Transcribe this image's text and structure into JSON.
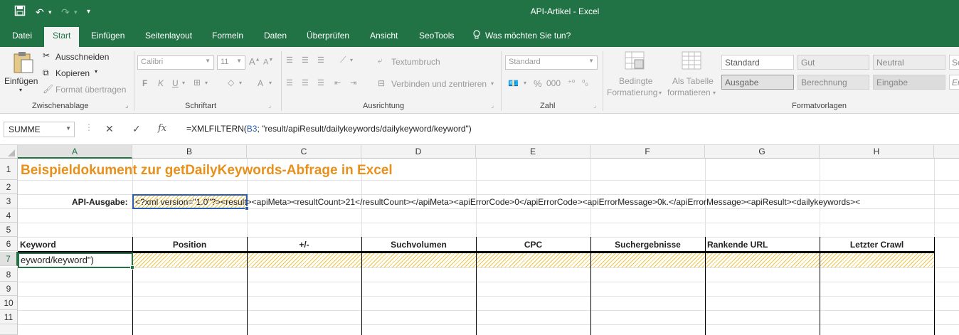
{
  "titlebar": {
    "title": "API-Artikel - Excel"
  },
  "tabs": [
    "Datei",
    "Start",
    "Einfügen",
    "Seitenlayout",
    "Formeln",
    "Daten",
    "Überprüfen",
    "Ansicht",
    "SeoTools"
  ],
  "tell_me": "Was möchten Sie tun?",
  "ribbon": {
    "clipboard": {
      "paste": "Einfügen",
      "cut": "Ausschneiden",
      "copy": "Kopieren",
      "format_painter": "Format übertragen",
      "label": "Zwischenablage"
    },
    "font": {
      "name": "Calibri",
      "size": "11",
      "label": "Schriftart"
    },
    "alignment": {
      "wrap": "Textumbruch",
      "merge": "Verbinden und zentrieren",
      "label": "Ausrichtung"
    },
    "number": {
      "format": "Standard",
      "label": "Zahl"
    },
    "styles": {
      "conditional_1": "Bedingte",
      "conditional_2": "Formatierung",
      "table_1": "Als Tabelle",
      "table_2": "formatieren",
      "label": "Formatvorlagen",
      "cells": [
        "Standard",
        "Gut",
        "Neutral",
        "Sc",
        "Ausgabe",
        "Berechnung",
        "Eingabe",
        "Er"
      ]
    }
  },
  "formula_bar": {
    "name_box": "SUMME",
    "prefix": "=XMLFILTERN(",
    "ref": "B3",
    "suffix": "; \"result/apiResult/dailykeywords/dailykeyword/keyword\")"
  },
  "columns": [
    "A",
    "B",
    "C",
    "D",
    "E",
    "F",
    "G",
    "H"
  ],
  "rows": [
    "1",
    "2",
    "3",
    "4",
    "5",
    "6",
    "7",
    "8",
    "9",
    "10",
    "11"
  ],
  "sheet": {
    "title": "Beispieldokument zur getDailyKeywords-Abfrage in Excel",
    "api_label": "API-Ausgabe:",
    "api_value_start": "<?xml version=\"1.0\"?><re",
    "api_value_rest": "sult><apiMeta><resultCount>21</resultCount></apiMeta><apiErrorCode>0</apiErrorCode><apiErrorMessage>0k.</apiErrorMessage><apiResult><dailykeywords><",
    "headers": [
      "Keyword",
      "Position",
      "+/-",
      "Suchvolumen",
      "CPC",
      "Suchergebnisse",
      "Rankende URL",
      "Letzter Crawl"
    ],
    "editing_text": "eyword/keyword\")"
  },
  "colors": {
    "accent": "#217346",
    "title": "#e8901a",
    "hatch": "#f0c030"
  }
}
